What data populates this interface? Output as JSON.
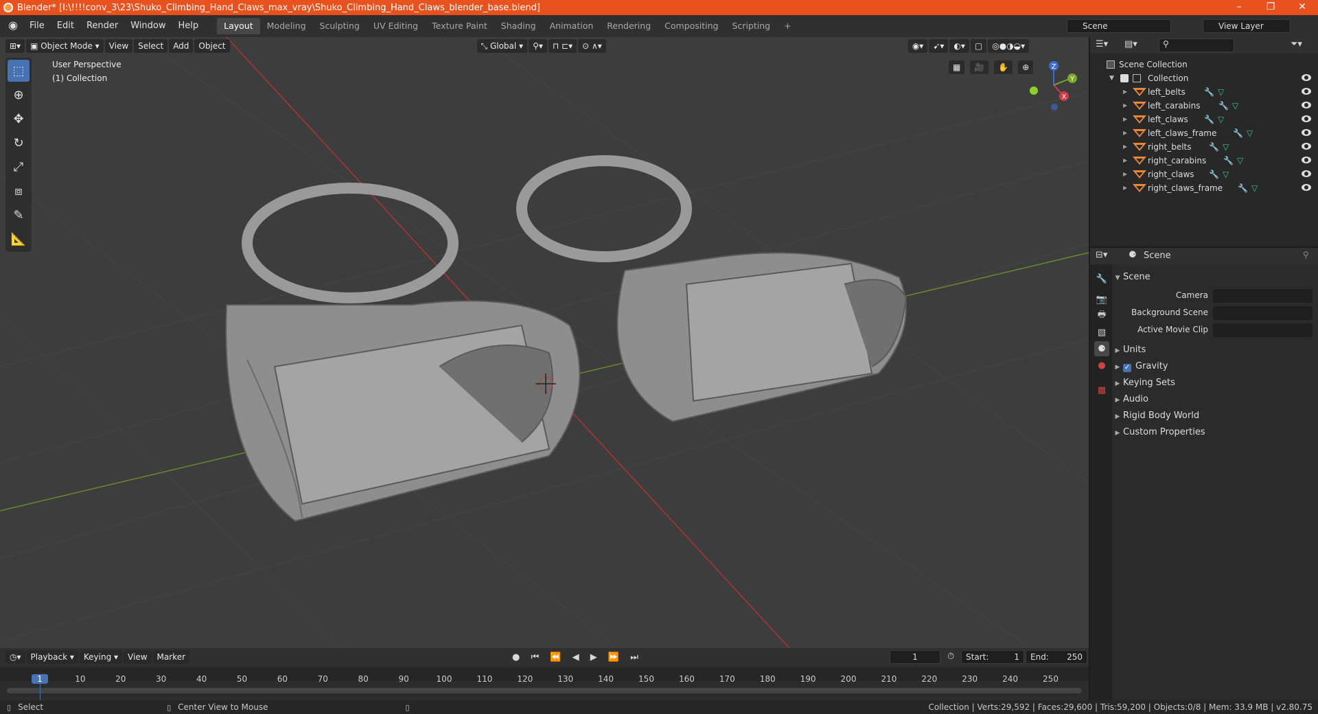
{
  "window": {
    "title": "Blender* [I:\\!!!!conv_3\\23\\Shuko_Climbing_Hand_Claws_max_vray\\Shuko_Climbing_Hand_Claws_blender_base.blend]",
    "minimize": "–",
    "maximize": "❐",
    "close": "✕"
  },
  "menu": [
    "File",
    "Edit",
    "Render",
    "Window",
    "Help"
  ],
  "workspaces": [
    "Layout",
    "Modeling",
    "Sculpting",
    "UV Editing",
    "Texture Paint",
    "Shading",
    "Animation",
    "Rendering",
    "Compositing",
    "Scripting"
  ],
  "add_workspace": "+",
  "scene_field": "Scene",
  "view_layer_field": "View Layer",
  "viewport": {
    "mode": "Object Mode",
    "menus": [
      "View",
      "Select",
      "Add",
      "Object"
    ],
    "orientation": "Global",
    "overlay_line1": "User Perspective",
    "overlay_line2": "(1) Collection"
  },
  "gizmo": {
    "x": "X",
    "y": "Y",
    "z": "Z"
  },
  "outliner": {
    "root": "Scene Collection",
    "collection": "Collection",
    "items": [
      "left_belts",
      "left_carabins",
      "left_claws",
      "left_claws_frame",
      "right_belts",
      "right_carabins",
      "right_claws",
      "right_claws_frame"
    ]
  },
  "properties": {
    "header": "Scene",
    "section": "Scene",
    "camera_label": "Camera",
    "background_scene_label": "Background Scene",
    "active_movie_clip_label": "Active Movie Clip",
    "subsections": [
      "Units",
      "Gravity",
      "Keying Sets",
      "Audio",
      "Rigid Body World",
      "Custom Properties"
    ],
    "gravity_checked": true
  },
  "timeline": {
    "menus": [
      "Playback",
      "Keying",
      "View",
      "Marker"
    ],
    "current_frame": "1",
    "start_label": "Start:",
    "start": "1",
    "end_label": "End:",
    "end": "250",
    "ticks": [
      "1",
      "10",
      "20",
      "30",
      "40",
      "50",
      "60",
      "70",
      "80",
      "90",
      "100",
      "110",
      "120",
      "130",
      "140",
      "150",
      "160",
      "170",
      "180",
      "190",
      "200",
      "210",
      "220",
      "230",
      "240",
      "250"
    ]
  },
  "status": {
    "select": "Select",
    "center": "Center View to Mouse",
    "stats": "Collection | Verts:29,592 | Faces:29,600 | Tris:59,200 | Objects:0/8 | Mem: 33.9 MB | v2.80.75"
  }
}
